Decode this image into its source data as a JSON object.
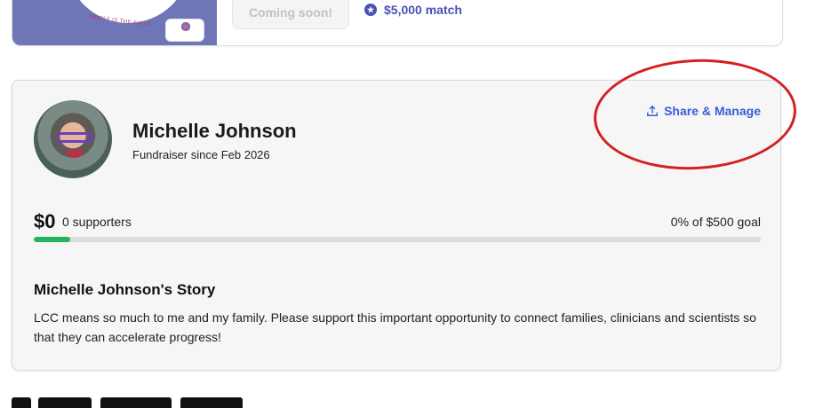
{
  "top_card": {
    "coming_soon_label": "Coming soon!",
    "match_text": "$5,000 match",
    "banner_text": "FAMILY IS THE FIRST",
    "match_icon": "badge-icon"
  },
  "fundraiser": {
    "name": "Michelle Johnson",
    "since": "Fundraiser since Feb 2026",
    "share_label": "Share & Manage",
    "share_icon": "upload-icon",
    "amount": "$0",
    "supporters": "0 supporters",
    "goal_text": "0% of $500 goal",
    "progress_fraction": 0.05,
    "progress_color": "#24b35a",
    "story_title": "Michelle Johnson's Story",
    "story_text": "LCC means so much to me and my family. Please support this important opportunity to connect families, clinicians and scientists so that they can accelerate progress!"
  },
  "colors": {
    "accent": "#3b5bdb",
    "annotation": "#d42020",
    "banner": "#6f76b8"
  }
}
